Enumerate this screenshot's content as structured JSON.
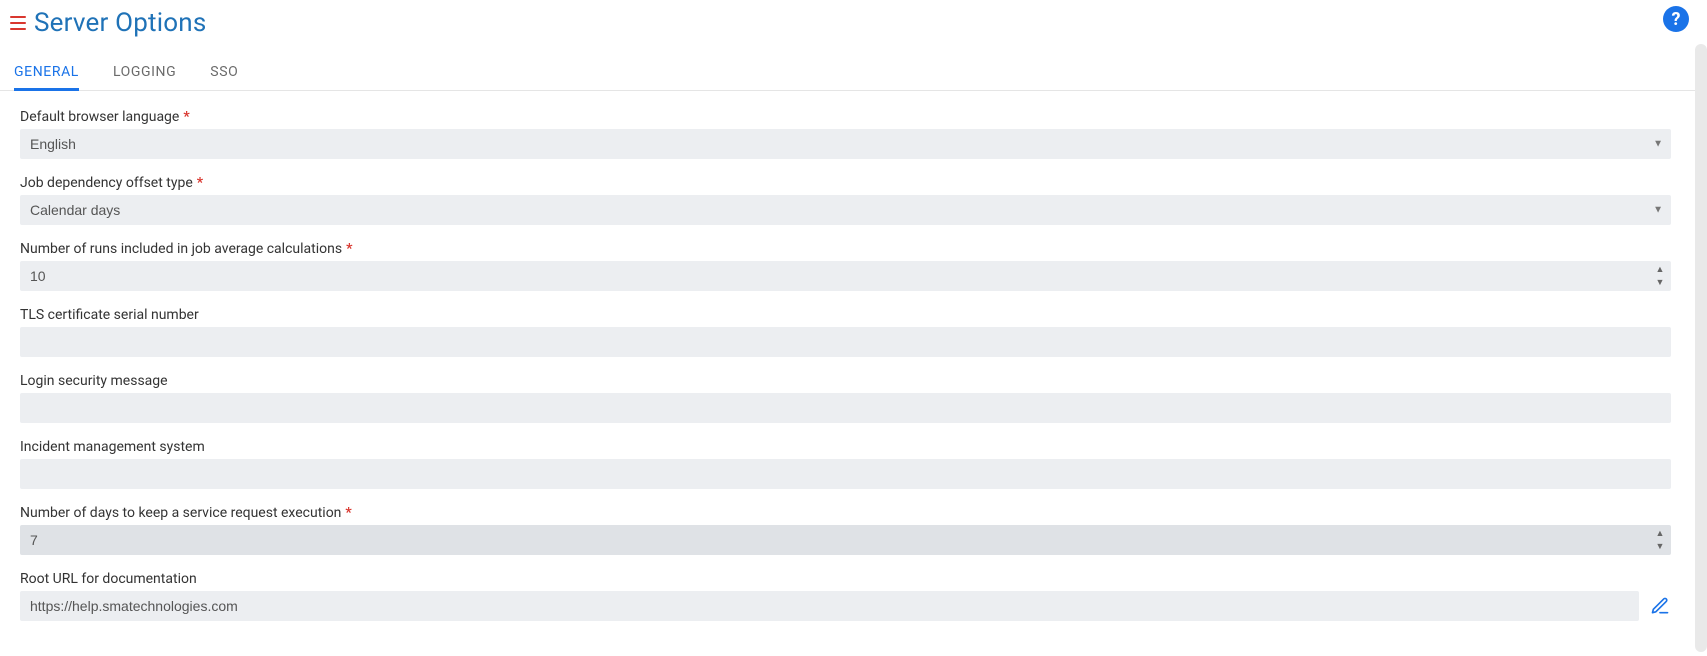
{
  "header": {
    "title": "Server Options"
  },
  "tabs": [
    {
      "id": "general",
      "label": "GENERAL",
      "active": true
    },
    {
      "id": "logging",
      "label": "LOGGING",
      "active": false
    },
    {
      "id": "sso",
      "label": "SSO",
      "active": false
    }
  ],
  "fields": {
    "default_language": {
      "label": "Default browser language",
      "required": true,
      "value": "English"
    },
    "job_dep_offset": {
      "label": "Job dependency offset type",
      "required": true,
      "value": "Calendar days"
    },
    "num_runs": {
      "label": "Number of runs included in job average calculations",
      "required": true,
      "value": "10"
    },
    "tls_serial": {
      "label": "TLS certificate serial number",
      "required": false,
      "value": ""
    },
    "login_msg": {
      "label": "Login security message",
      "required": false,
      "value": ""
    },
    "incident_mgmt": {
      "label": "Incident management system",
      "required": false,
      "value": ""
    },
    "days_service_exec": {
      "label": "Number of days to keep a service request execution",
      "required": true,
      "value": "7"
    },
    "root_doc_url": {
      "label": "Root URL for documentation",
      "required": false,
      "value": "https://help.smatechnologies.com"
    }
  }
}
